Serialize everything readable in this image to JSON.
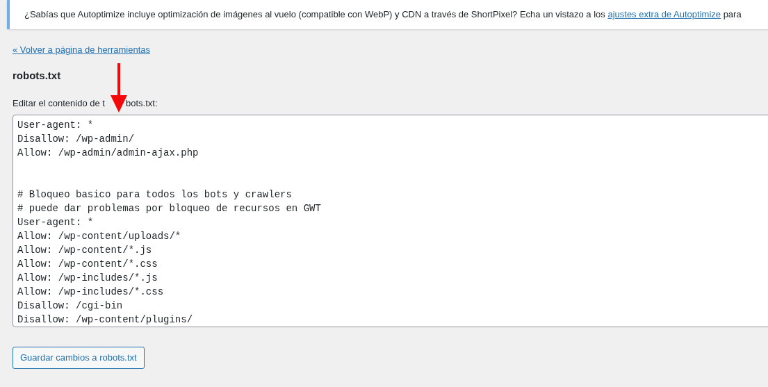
{
  "notice": {
    "text": "¿Sabías que Autoptimize incluye optimización de imágenes al vuelo (compatible con WebP) y CDN a través de ShortPixel? Echa un vistazo a los ",
    "link": "ajustes extra de Autoptimize",
    "after": " para"
  },
  "back_link": "« Volver a página de herramientas",
  "heading": "robots.txt",
  "field_label": {
    "before": "Editar el contenido de t",
    "after": "bots.txt:"
  },
  "editor": {
    "value": "User-agent: *\nDisallow: /wp-admin/\nAllow: /wp-admin/admin-ajax.php\n\n\n# Bloqueo basico para todos los bots y crawlers\n# puede dar problemas por bloqueo de recursos en GWT\nUser-agent: *\nAllow: /wp-content/uploads/*\nAllow: /wp-content/*.js\nAllow: /wp-content/*.css\nAllow: /wp-includes/*.js\nAllow: /wp-includes/*.css\nDisallow: /cgi-bin\nDisallow: /wp-content/plugins/"
  },
  "save_button": "Guardar cambios a robots.txt"
}
